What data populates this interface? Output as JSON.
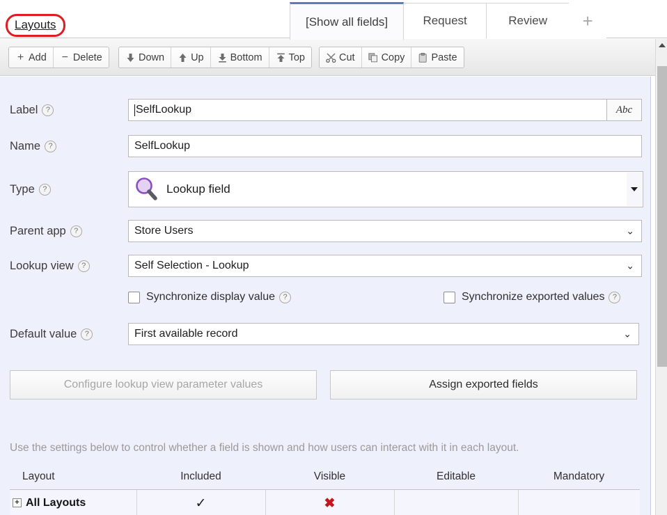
{
  "breadcrumb": {
    "link_label": "Layouts"
  },
  "tabs": {
    "items": [
      {
        "label": "[Show all fields]",
        "active": true
      },
      {
        "label": "Request",
        "active": false
      },
      {
        "label": "Review",
        "active": false
      }
    ],
    "add_tab_glyph": "+"
  },
  "toolbar": {
    "groups": [
      {
        "buttons": [
          {
            "label": "Add",
            "icon": "plus-icon",
            "glyph": "+"
          },
          {
            "label": "Delete",
            "icon": "minus-icon",
            "glyph": "−"
          }
        ]
      },
      {
        "buttons": [
          {
            "label": "Down",
            "icon": "arrow-down-icon",
            "glyph": "⬇"
          },
          {
            "label": "Up",
            "icon": "arrow-up-icon",
            "glyph": "⬆"
          },
          {
            "label": "Bottom",
            "icon": "move-to-bottom-icon",
            "glyph": "⤓"
          },
          {
            "label": "Top",
            "icon": "move-to-top-icon",
            "glyph": "⤒"
          }
        ]
      },
      {
        "buttons": [
          {
            "label": "Cut",
            "icon": "scissors-icon",
            "glyph": "✂"
          },
          {
            "label": "Copy",
            "icon": "copy-icon",
            "glyph": "⧉"
          },
          {
            "label": "Paste",
            "icon": "clipboard-icon",
            "glyph": "📋"
          }
        ]
      }
    ]
  },
  "form": {
    "help_glyph": "?",
    "label_field": {
      "label": "Label",
      "value": "SelfLookup",
      "format_button": "Abc"
    },
    "name_field": {
      "label": "Name",
      "value": "SelfLookup"
    },
    "type_field": {
      "label": "Type",
      "value": "Lookup field",
      "icon": "magnifier-icon"
    },
    "parent_app_field": {
      "label": "Parent app",
      "value": "Store Users"
    },
    "lookup_view_field": {
      "label": "Lookup view",
      "value": "Self Selection - Lookup"
    },
    "checkboxes": [
      {
        "label": "Synchronize display value",
        "checked": false
      },
      {
        "label": "Synchronize exported values",
        "checked": false
      }
    ],
    "default_value_field": {
      "label": "Default value",
      "value": "First available record"
    },
    "action_buttons": [
      {
        "label": "Configure lookup view parameter values",
        "disabled": true
      },
      {
        "label": "Assign exported fields",
        "disabled": false
      }
    ],
    "hint": "Use the settings below to control whether a field is shown and how users can interact with it in each layout."
  },
  "layout_table": {
    "columns": [
      "Layout",
      "Included",
      "Visible",
      "Editable",
      "Mandatory"
    ],
    "rows": [
      {
        "layout": "All Layouts",
        "expander": "+",
        "included": "✓",
        "visible": "✖",
        "editable": "",
        "mandatory": ""
      }
    ]
  },
  "scrollbar": {
    "up_arrow": "▲"
  },
  "colors": {
    "accent_tab": "#5b7bbf",
    "annotation": "#e01b22",
    "form_bg": "#eef0fb",
    "error_mark": "#c4161c",
    "lookup_icon": "#8a4fc4"
  }
}
